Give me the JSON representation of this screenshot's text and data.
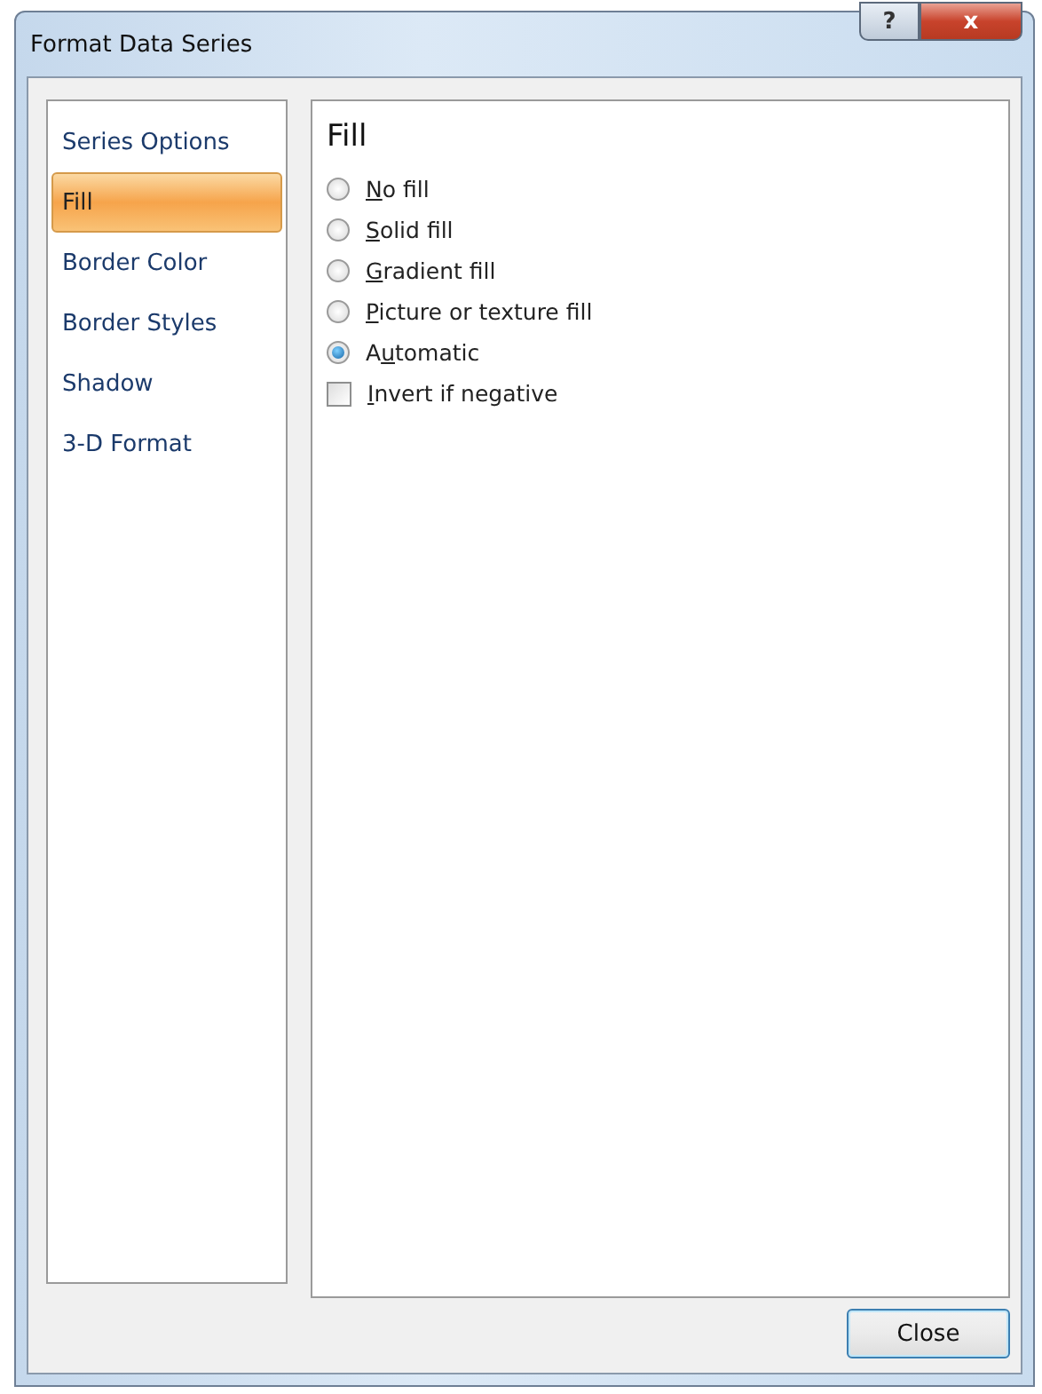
{
  "window": {
    "title": "Format Data Series",
    "help_button": "?",
    "close_button": "x"
  },
  "sidebar": {
    "items": [
      {
        "label": "Series Options",
        "selected": false
      },
      {
        "label": "Fill",
        "selected": true
      },
      {
        "label": "Border Color",
        "selected": false
      },
      {
        "label": "Border Styles",
        "selected": false
      },
      {
        "label": "Shadow",
        "selected": false
      },
      {
        "label": "3-D Format",
        "selected": false
      }
    ]
  },
  "panel": {
    "heading": "Fill",
    "options": [
      {
        "kind": "radio",
        "key": "N",
        "after": "o fill",
        "selected": false
      },
      {
        "kind": "radio",
        "key": "S",
        "after": "olid fill",
        "selected": false
      },
      {
        "kind": "radio",
        "key": "G",
        "after": "radient fill",
        "selected": false
      },
      {
        "kind": "radio",
        "key": "P",
        "after": "icture or texture fill",
        "selected": false
      },
      {
        "kind": "radio",
        "before": "A",
        "key": "u",
        "after": "tomatic",
        "selected": true
      },
      {
        "kind": "checkbox",
        "key": "I",
        "after": "nvert if negative",
        "checked": false
      }
    ]
  },
  "buttons": [
    "Close"
  ]
}
